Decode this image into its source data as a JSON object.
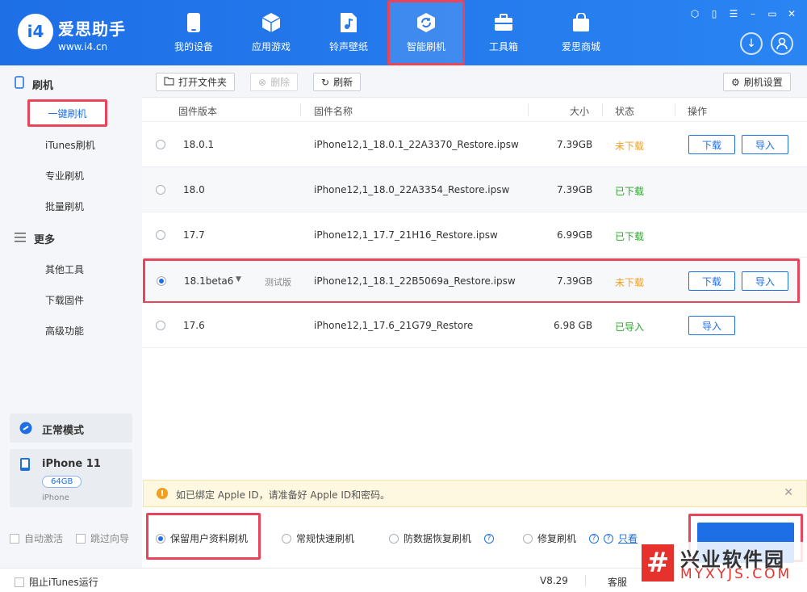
{
  "brand": {
    "logo": "i4",
    "name": "爱思助手",
    "url": "www.i4.cn"
  },
  "nav": [
    {
      "label": "我的设备",
      "icon": "phone-icon"
    },
    {
      "label": "应用游戏",
      "icon": "cube-icon"
    },
    {
      "label": "铃声壁纸",
      "icon": "music-file-icon"
    },
    {
      "label": "智能刷机",
      "icon": "flash-refresh-icon"
    },
    {
      "label": "工具箱",
      "icon": "toolbox-icon"
    },
    {
      "label": "爱思商城",
      "icon": "shopping-bag-icon"
    }
  ],
  "sidebar": {
    "section1": "刷机",
    "items1": [
      "一键刷机",
      "iTunes刷机",
      "专业刷机",
      "批量刷机"
    ],
    "section2": "更多",
    "items2": [
      "其他工具",
      "下载固件",
      "高级功能"
    ],
    "mode": "正常模式",
    "device": {
      "name": "iPhone 11",
      "capacity": "64GB",
      "type": "iPhone"
    },
    "auto_activate": "自动激活",
    "skip_guide": "跳过向导"
  },
  "toolbar": {
    "open_folder": "打开文件夹",
    "delete": "删除",
    "refresh": "刷新",
    "settings": "刷机设置"
  },
  "table": {
    "headers": {
      "version": "固件版本",
      "name": "固件名称",
      "size": "大小",
      "status": "状态",
      "action": "操作"
    },
    "rows": [
      {
        "version": "18.0.1",
        "tag": "",
        "name": "iPhone12,1_18.0.1_22A3370_Restore.ipsw",
        "size": "7.39GB",
        "status": "未下载"
      },
      {
        "version": "18.0",
        "tag": "",
        "name": "iPhone12,1_18.0_22A3354_Restore.ipsw",
        "size": "7.39GB",
        "status": "已下载"
      },
      {
        "version": "17.7",
        "tag": "",
        "name": "iPhone12,1_17.7_21H16_Restore.ipsw",
        "size": "6.99GB",
        "status": "已下载"
      },
      {
        "version": "18.1beta6",
        "tag": "测试版",
        "name": "iPhone12,1_18.1_22B5069a_Restore.ipsw",
        "size": "7.39GB",
        "status": "未下载"
      },
      {
        "version": "17.6",
        "tag": "",
        "name": "iPhone12,1_17.6_21G79_Restore",
        "size": "6.98 GB",
        "status": "已导入"
      }
    ],
    "download": "下载",
    "import": "导入"
  },
  "notice": "如已绑定 Apple ID，请准备好 Apple ID和密码。",
  "options": [
    "保留用户资料刷机",
    "常规快速刷机",
    "防数据恢复刷机",
    "修复刷机",
    "只看"
  ],
  "statusbar": {
    "block_itunes": "阻止iTunes运行",
    "version": "V8.29",
    "service": "客服"
  },
  "watermark": {
    "logo": "#",
    "title": "兴业软件园",
    "url": "MYXYJS.COM"
  },
  "colors": {
    "primary": "#1e6fe6",
    "highlight": "#e8455a",
    "not_downloaded": "#f0a020",
    "downloaded": "#2aa52a"
  }
}
